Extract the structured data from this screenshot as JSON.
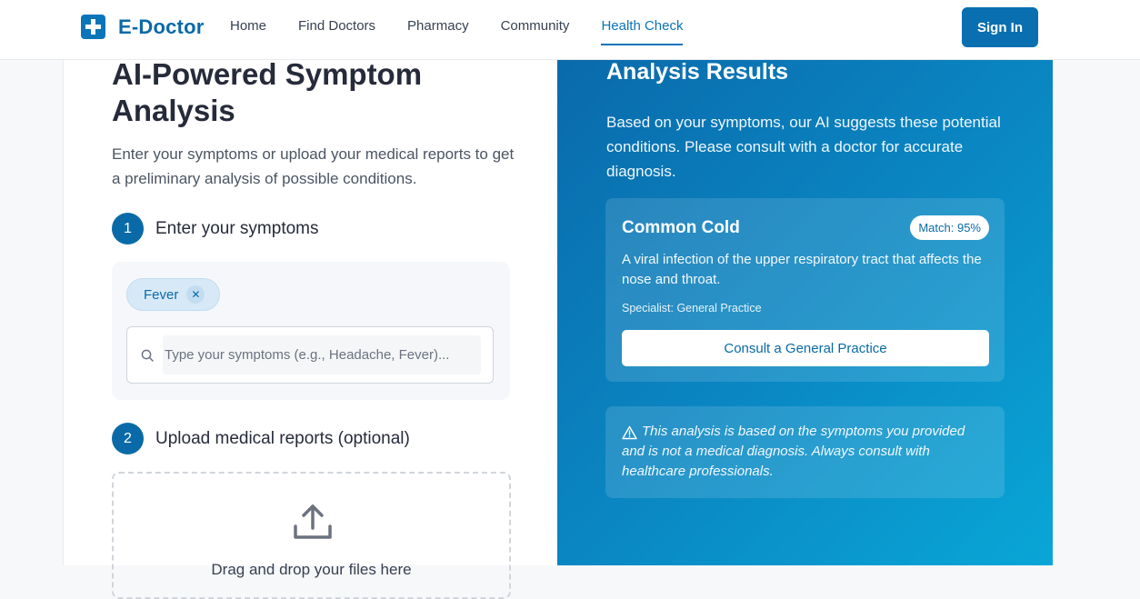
{
  "brand": {
    "name": "E-Doctor"
  },
  "nav": {
    "items": [
      "Home",
      "Find Doctors",
      "Pharmacy",
      "Community",
      "Health Check"
    ],
    "active": "Health Check"
  },
  "header": {
    "signin_label": "Sign In"
  },
  "left": {
    "title": "AI-Powered Symptom Analysis",
    "subtitle": "Enter your symptoms or upload your medical reports to get a preliminary analysis of possible conditions.",
    "step1": {
      "number": "1",
      "label": "Enter your symptoms"
    },
    "symptoms": [
      "Fever"
    ],
    "search_placeholder": "Type your symptoms (e.g., Headache, Fever)...",
    "step2": {
      "number": "2",
      "label": "Upload medical reports (optional)"
    },
    "upload_text": "Drag and drop your files here"
  },
  "right": {
    "title": "Analysis Results",
    "intro": "Based on your symptoms, our AI suggests these potential conditions. Please consult with a doctor for accurate diagnosis.",
    "condition": {
      "name": "Common Cold",
      "match": "Match: 95%",
      "description": "A viral infection of the upper respiratory tract that affects the nose and throat.",
      "specialist": "Specialist: General Practice",
      "button": "Consult a General Practice"
    },
    "disclaimer": "This analysis is based on the symptoms you provided and is not a medical diagnosis. Always consult with healthcare professionals."
  },
  "colors": {
    "brand": "#0a6aa7",
    "accent": "#0a75b8",
    "panel_gradient_start": "#0a6aab",
    "panel_gradient_end": "#09a6d6"
  },
  "icons": {
    "logo": "medical-cross-icon",
    "chip_remove": "close-icon",
    "search": "search-icon",
    "upload": "upload-icon",
    "warning": "warning-triangle-icon"
  }
}
